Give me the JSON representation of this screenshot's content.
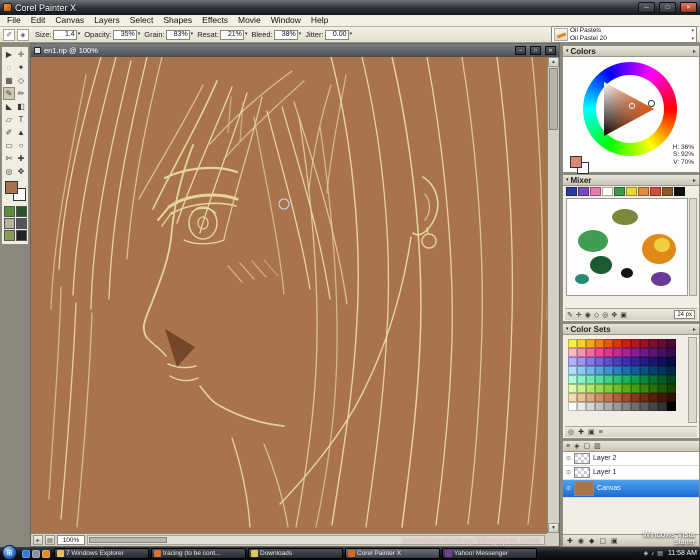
{
  "window": {
    "title": "Corel Painter X",
    "controls": {
      "minimize": "─",
      "maximize": "□",
      "close": "✕"
    }
  },
  "icons": {
    "chevron": "▾",
    "expand": "▾",
    "panel_menu": "▸",
    "up": "▲",
    "down": "▼",
    "left": "◀",
    "right": "▶",
    "eye": "⊙",
    "start": "⊞"
  },
  "menu": {
    "items": [
      "File",
      "Edit",
      "Canvas",
      "Layers",
      "Select",
      "Shapes",
      "Effects",
      "Movie",
      "Window",
      "Help"
    ]
  },
  "property_bar": {
    "left_icons": [
      {
        "name": "brush-ghost-icon",
        "glyph": "✐"
      },
      {
        "name": "rotate-page-icon",
        "glyph": "◈"
      }
    ],
    "fields": [
      {
        "label": "Size:",
        "value": "1.4"
      },
      {
        "label": "Opacity:",
        "value": "35%"
      },
      {
        "label": "Grain:",
        "value": "83%"
      },
      {
        "label": "Resat:",
        "value": "21%"
      },
      {
        "label": "Bleed:",
        "value": "38%"
      },
      {
        "label": "Jitter:",
        "value": "0.00"
      }
    ]
  },
  "brush_selector": {
    "category": "Oil Pastels",
    "variant": "Oil Pastel 20"
  },
  "toolbox": {
    "tools": [
      {
        "name": "pointer-tool",
        "glyph": "▶"
      },
      {
        "name": "layer-adjuster-tool",
        "glyph": "✛"
      },
      {
        "name": "lasso-tool",
        "glyph": "◌"
      },
      {
        "name": "magic-wand-tool",
        "glyph": "✦"
      },
      {
        "name": "crop-tool",
        "glyph": "▦"
      },
      {
        "name": "selection-adjuster-tool",
        "glyph": "◇"
      },
      {
        "name": "brush-tool",
        "glyph": "✎",
        "selected": true
      },
      {
        "name": "cloner-tool",
        "glyph": "✏"
      },
      {
        "name": "dropper-tool",
        "glyph": "◣"
      },
      {
        "name": "paint-bucket-tool",
        "glyph": "◧"
      },
      {
        "name": "eraser-tool",
        "glyph": "▱"
      },
      {
        "name": "text-tool",
        "glyph": "T"
      },
      {
        "name": "pen-tool",
        "glyph": "✐"
      },
      {
        "name": "shape-selection-tool",
        "glyph": "▲"
      },
      {
        "name": "rect-shape-tool",
        "glyph": "▭"
      },
      {
        "name": "oval-shape-tool",
        "glyph": "○"
      },
      {
        "name": "scissors-tool",
        "glyph": "✄"
      },
      {
        "name": "add-point-tool",
        "glyph": "✚"
      },
      {
        "name": "magnifier-tool",
        "glyph": "◎"
      },
      {
        "name": "grabber-tool",
        "glyph": "✥"
      }
    ],
    "primary_color": "#a9734d",
    "secondary_color": "#ffffff",
    "selectors": [
      "#5a8f3c",
      "#2c4f2c",
      "#b9b29b",
      "#555555",
      "#8a9a5a",
      "#222222"
    ]
  },
  "document": {
    "title": "en1.rip @ 100%",
    "zoom": "100%",
    "canvas_color": "#a9734d",
    "watermark": "annelorraineuy.blogspot.com",
    "bottom_tools": [
      {
        "name": "drawing-mode-icon",
        "glyph": "▸"
      },
      {
        "name": "tracing-paper-icon",
        "glyph": "▤"
      }
    ]
  },
  "colors_panel": {
    "title": "Colors",
    "hsv": {
      "h": "H: 36%",
      "s": "S: 92%",
      "v": "V: 70%"
    },
    "primary": "#d88a72",
    "secondary": "#ffffff"
  },
  "mixer_panel": {
    "title": "Mixer",
    "size_label": "24 px",
    "swatches": [
      "#2a3a9a",
      "#7a4aba",
      "#e87ab0",
      "#ffffff",
      "#3a9a4a",
      "#e8d83a",
      "#e8883a",
      "#d84a3a",
      "#8a5a2a",
      "#101010"
    ],
    "tools": [
      {
        "name": "dirty-brush-icon",
        "glyph": "✎"
      },
      {
        "name": "apply-color-icon",
        "glyph": "✛"
      },
      {
        "name": "mix-color-icon",
        "glyph": "◉"
      },
      {
        "name": "sample-color-icon",
        "glyph": "◇"
      },
      {
        "name": "zoom-mixer-icon",
        "glyph": "◎"
      },
      {
        "name": "pan-mixer-icon",
        "glyph": "✥"
      },
      {
        "name": "clear-mixer-icon",
        "glyph": "▣"
      }
    ]
  },
  "color_sets_panel": {
    "title": "Color Sets",
    "tools": [
      {
        "name": "find-color-icon",
        "glyph": "◎"
      },
      {
        "name": "add-color-icon",
        "glyph": "✚"
      },
      {
        "name": "delete-color-icon",
        "glyph": "▣"
      },
      {
        "name": "list-view-icon",
        "glyph": "≡"
      }
    ],
    "palette": [
      "#f9ef4a",
      "#f7d028",
      "#f4a81c",
      "#ef7d14",
      "#e85510",
      "#dd3410",
      "#cc1f14",
      "#b3161f",
      "#991129",
      "#7f0e31",
      "#660b35",
      "#4d0a33",
      "#f9b8c8",
      "#f791b4",
      "#f56ba2",
      "#ef4a95",
      "#dd3693",
      "#c42a96",
      "#a82298",
      "#8c1c92",
      "#731a86",
      "#5c1677",
      "#471263",
      "#340e4f",
      "#b8aef9",
      "#9e92f2",
      "#8678e8",
      "#7162dd",
      "#5e4ecf",
      "#4d3ec0",
      "#3e30ae",
      "#31259c",
      "#261c87",
      "#1c1572",
      "#140f5c",
      "#0d0a47",
      "#aedcf9",
      "#8ecbf2",
      "#6fb8e8",
      "#54a5dd",
      "#3d92cf",
      "#2a80c0",
      "#1c6fae",
      "#125f9c",
      "#0a5087",
      "#064272",
      "#03355c",
      "#022947",
      "#aef9dc",
      "#8ef2c8",
      "#6fe8b2",
      "#54dd9c",
      "#3dcf87",
      "#2ac072",
      "#1cae5f",
      "#129c4e",
      "#0a873f",
      "#067232",
      "#035c27",
      "#02471d",
      "#def9ae",
      "#c8f28e",
      "#b0e86f",
      "#98dd54",
      "#82cf3d",
      "#6cc02a",
      "#58ae1c",
      "#479c12",
      "#37870a",
      "#2a7206",
      "#1f5c03",
      "#154702",
      "#f2dab8",
      "#e8c299",
      "#dda87c",
      "#cf8f62",
      "#c0774b",
      "#ae6038",
      "#9c4c28",
      "#873a1b",
      "#722c11",
      "#5c2009",
      "#471705",
      "#330f02",
      "#ffffff",
      "#ebebeb",
      "#d6d6d6",
      "#c2c2c2",
      "#adadad",
      "#999999",
      "#858585",
      "#707070",
      "#5c5c5c",
      "#474747",
      "#333333",
      "#000000"
    ]
  },
  "layers_panel": {
    "top_tools": [
      {
        "name": "layer-commands-icon",
        "glyph": "≡"
      },
      {
        "name": "dynamic-plugins-icon",
        "glyph": "◈"
      },
      {
        "name": "preserve-transparency-icon",
        "glyph": "▢"
      },
      {
        "name": "pickup-underlying-icon",
        "glyph": "▥"
      }
    ],
    "bottom_tools": [
      {
        "name": "new-layer-icon",
        "glyph": "✚"
      },
      {
        "name": "new-watercolor-layer-icon",
        "glyph": "◉"
      },
      {
        "name": "new-liquid-ink-layer-icon",
        "glyph": "◆"
      },
      {
        "name": "layer-mask-icon",
        "glyph": "▢"
      },
      {
        "name": "delete-layer-icon",
        "glyph": "▣"
      }
    ],
    "layers": [
      {
        "name": "Layer 2",
        "thumb": "checker",
        "selected": false
      },
      {
        "name": "Layer 1",
        "thumb": "checker",
        "selected": false
      },
      {
        "name": "Canvas",
        "thumb": "#a9734d",
        "selected": true
      }
    ]
  },
  "vista": {
    "line1": "Windows Vista",
    "line2": "Starter"
  },
  "taskbar": {
    "quicklaunch": [
      {
        "name": "internet-explorer-icon",
        "color": "#2a7ae0"
      },
      {
        "name": "show-desktop-icon",
        "color": "#8a9298"
      },
      {
        "name": "media-player-icon",
        "color": "#e08a20"
      }
    ],
    "buttons": [
      {
        "label": "7 Windows Explorer",
        "color": "#e8c35a",
        "active": false
      },
      {
        "label": "tracing (to be cont...",
        "color": "#e07030",
        "active": false
      },
      {
        "label": "Downloads",
        "color": "#e8c35a",
        "active": false
      },
      {
        "label": "Corel Painter X",
        "color": "#d86a20",
        "active": true
      },
      {
        "label": "Yahoo! Messenger",
        "color": "#7a3a9a",
        "active": false
      }
    ],
    "tray_icons": [
      {
        "name": "messenger-tray-icon",
        "glyph": "◈"
      },
      {
        "name": "volume-icon",
        "glyph": "♪"
      },
      {
        "name": "network-icon",
        "glyph": "▤"
      }
    ],
    "clock": "11:58 AM"
  }
}
